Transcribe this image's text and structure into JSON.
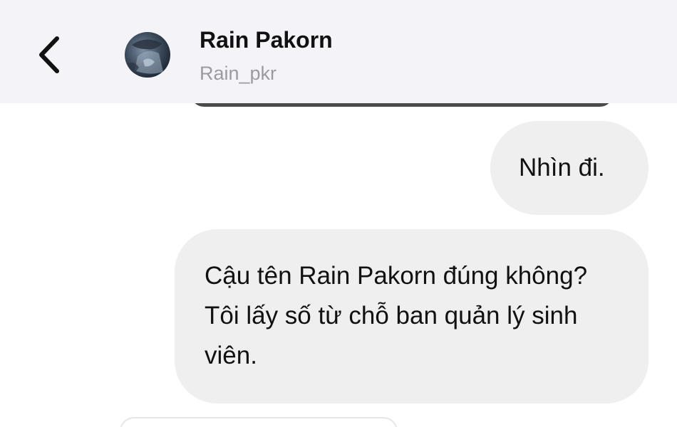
{
  "header": {
    "back_icon": "chevron-left-icon",
    "contact_name": "Rain Pakorn",
    "contact_handle": "Rain_pkr"
  },
  "messages": [
    {
      "direction": "outgoing",
      "text": "Nhìn đi."
    },
    {
      "direction": "outgoing",
      "text": "Cậu tên Rain Pakorn đúng không? Tôi lấy số từ chỗ ban quản lý sinh viên."
    }
  ],
  "colors": {
    "header_bg": "#f4f4f8",
    "bubble_bg": "#efefef",
    "text": "#111111",
    "secondary_text": "#9a9aa0"
  }
}
